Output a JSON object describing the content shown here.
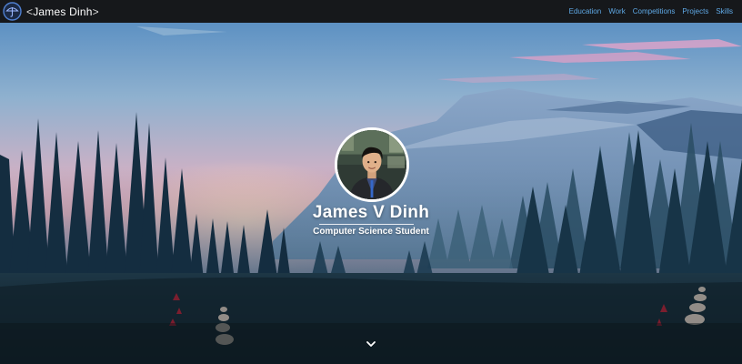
{
  "navbar": {
    "logo_icon": "umbrella-logo-icon",
    "brand_open": "<",
    "brand_name": "James Dinh",
    "brand_close": ">",
    "links": [
      {
        "label": "Education"
      },
      {
        "label": "Work"
      },
      {
        "label": "Competitions"
      },
      {
        "label": "Projects"
      },
      {
        "label": "Skills"
      }
    ]
  },
  "hero": {
    "name": "James V Dinh",
    "subtitle": "Computer Science Student",
    "avatar_icon": "profile-photo",
    "scroll_icon": "chevron-down-icon"
  },
  "colors": {
    "nav_background": "#16181b",
    "nav_link": "#5fa9e6",
    "sky_top": "#5b8fc2",
    "sky_pink": "#e8a6b6",
    "forest_dark": "#0f2534"
  }
}
